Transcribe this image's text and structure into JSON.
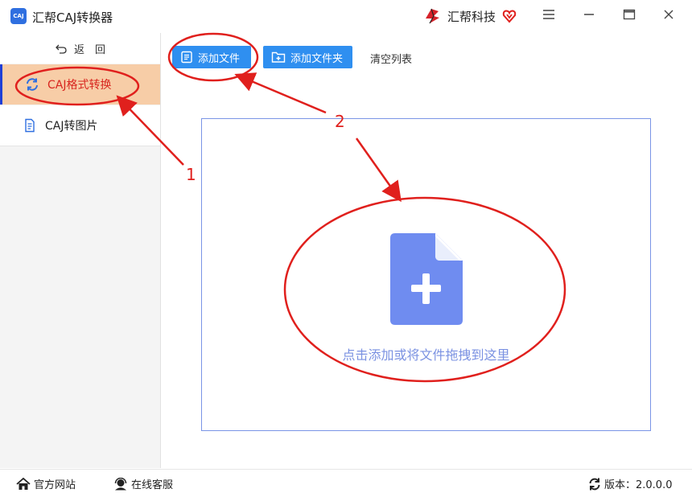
{
  "app": {
    "title": "汇帮CAJ转换器",
    "logo_text": "CAJ"
  },
  "brand": {
    "name": "汇帮科技"
  },
  "sidebar": {
    "back_label": "返　回",
    "items": [
      {
        "label": "CAJ格式转换",
        "icon": "refresh-icon",
        "active": true
      },
      {
        "label": "CAJ转图片",
        "icon": "document-icon",
        "active": false
      }
    ]
  },
  "toolbar": {
    "add_file_label": "添加文件",
    "add_folder_label": "添加文件夹",
    "clear_label": "清空列表"
  },
  "dropzone": {
    "hint": "点击添加或将文件拖拽到这里",
    "icon": "add-file-icon"
  },
  "footer": {
    "website_label": "官方网站",
    "service_label": "在线客服",
    "version_label": "版本：2.0.0.0"
  },
  "annotations": {
    "label_1": "1",
    "label_2": "2"
  },
  "colors": {
    "accent": "#2f8ff0",
    "active_bg": "#f7cda7",
    "active_text": "#d8261f",
    "annotation": "#e0201d",
    "drop_text": "#7b92e2"
  }
}
